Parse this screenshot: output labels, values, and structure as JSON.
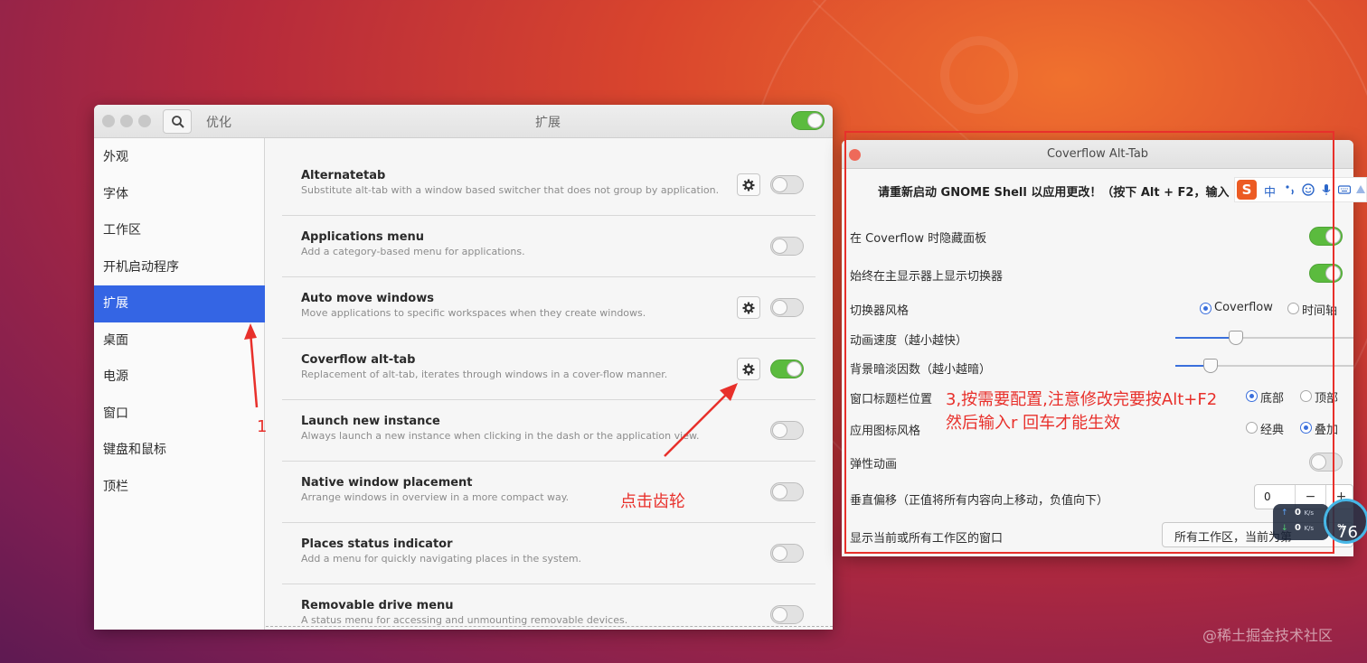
{
  "colors": {
    "accent": "#3465e4",
    "switch_on": "#5bbb3e",
    "annotation_red": "#e8302b",
    "close_button": "#ee6a5a"
  },
  "tweaks": {
    "app_title": "优化",
    "page_title": "扩展",
    "global_switch_on": true,
    "sidebar": {
      "items": [
        {
          "label": "外观",
          "active": false
        },
        {
          "label": "字体",
          "active": false
        },
        {
          "label": "工作区",
          "active": false
        },
        {
          "label": "开机启动程序",
          "active": false
        },
        {
          "label": "扩展",
          "active": true
        },
        {
          "label": "桌面",
          "active": false
        },
        {
          "label": "电源",
          "active": false
        },
        {
          "label": "窗口",
          "active": false
        },
        {
          "label": "键盘和鼠标",
          "active": false
        },
        {
          "label": "顶栏",
          "active": false
        }
      ]
    },
    "extensions": [
      {
        "name": "Alternatetab",
        "description": "Substitute alt-tab with a window based switcher that does not group by application.",
        "has_settings": true,
        "enabled": false
      },
      {
        "name": "Applications menu",
        "description": "Add a category-based menu for applications.",
        "has_settings": false,
        "enabled": false
      },
      {
        "name": "Auto move windows",
        "description": "Move applications to specific workspaces when they create windows.",
        "has_settings": true,
        "enabled": false
      },
      {
        "name": "Coverflow alt-tab",
        "description": "Replacement of alt-tab, iterates through windows in a cover-flow manner.",
        "has_settings": true,
        "enabled": true
      },
      {
        "name": "Launch new instance",
        "description": "Always launch a new instance when clicking in the dash or the application view.",
        "has_settings": false,
        "enabled": false
      },
      {
        "name": "Native window placement",
        "description": "Arrange windows in overview in a more compact way.",
        "has_settings": false,
        "enabled": false
      },
      {
        "name": "Places status indicator",
        "description": "Add a menu for quickly navigating places in the system.",
        "has_settings": false,
        "enabled": false
      },
      {
        "name": "Removable drive menu",
        "description": "A status menu for accessing and unmounting removable devices.",
        "has_settings": false,
        "enabled": false
      }
    ]
  },
  "coverflow": {
    "title": "Coverflow Alt-Tab",
    "notice": "请重新启动 GNOME Shell 以应用更改！（按下 Alt + F2，输入",
    "hide_panel": {
      "label": "在 Coverflow 时隐藏面板",
      "value": true
    },
    "primary_monitor": {
      "label": "始终在主显示器上显示切换器",
      "value": true
    },
    "switcher_style": {
      "label": "切换器风格",
      "options": [
        "Coverflow",
        "时间轴"
      ],
      "selected": 0
    },
    "animation_speed": {
      "label": "动画速度（越小越快）",
      "value": 0.34
    },
    "dim_factor": {
      "label": "背景暗淡因数（越小越暗）",
      "value": 0.2
    },
    "title_position": {
      "label": "窗口标题栏位置",
      "options": [
        "底部",
        "顶部"
      ],
      "selected": 0
    },
    "icon_style": {
      "label": "应用图标风格",
      "options": [
        "经典",
        "叠加"
      ],
      "selected": 1
    },
    "elastic": {
      "label": "弹性动画",
      "value": false
    },
    "vertical_offset": {
      "label": "垂直偏移（正值将所有内容向上移动，负值向下）",
      "value": "0",
      "minus": "−",
      "plus": "+"
    },
    "workspace_windows": {
      "label": "显示当前或所有工作区的窗口",
      "value": "所有工作区，当前为第"
    }
  },
  "ime": {
    "logo": "S",
    "lang": "中",
    "icons": [
      "punctuation-icon",
      "emoji-icon",
      "microphone-icon",
      "keyboard-icon",
      "skin-icon"
    ]
  },
  "annotations": {
    "step1": "1",
    "click_gear": "点击齿轮",
    "step3_line1": "3,按需要配置,注意修改完要按Alt+F2",
    "step3_line2": "然后输入r 回车才能生效"
  },
  "net_monitor": {
    "up": "0",
    "down": "0",
    "unit": "K/s",
    "percent": "76",
    "percent_sign": "%"
  },
  "watermark": "@稀土掘金技术社区"
}
